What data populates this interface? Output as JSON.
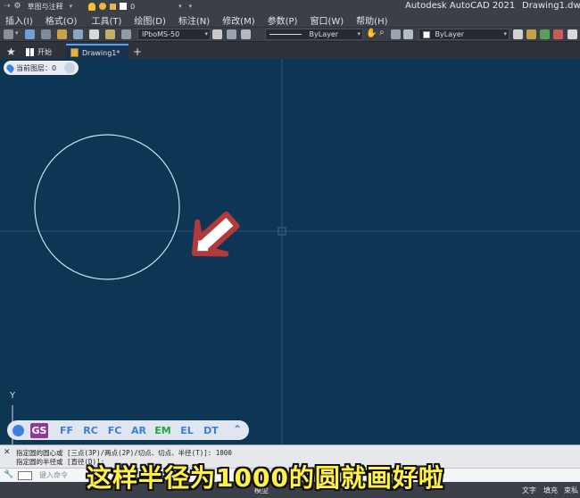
{
  "quick_access": {
    "workspace": "草图与注释",
    "layer": "0"
  },
  "title": {
    "app": "Autodesk AutoCAD 2021",
    "file": "Drawing1.dwg"
  },
  "menu": [
    "插入(I)",
    "格式(O)",
    "工具(T)",
    "绘图(D)",
    "标注(N)",
    "修改(M)",
    "参数(P)",
    "窗口(W)",
    "帮助(H)"
  ],
  "toolbar": {
    "dimstyle": "IPboMS-50",
    "linetype": "ByLayer",
    "color": "ByLayer"
  },
  "tabs": {
    "start": "开始",
    "drawing": "Drawing1*"
  },
  "canvas": {
    "layer_label": "当前图层：0",
    "axis_y": "Y",
    "background": "#0d3554"
  },
  "quick_commands": [
    "GS",
    "FF",
    "RC",
    "FC",
    "AR",
    "EM",
    "EL",
    "DT"
  ],
  "command_history": [
    "指定圆的圆心或 [三点(3P)/两点(2P)/切点、切点、半径(T)]: 1000",
    "指定圆的半径或 [直径(D)]:"
  ],
  "command_input": {
    "placeholder": "键入命令"
  },
  "status": {
    "model": "模型",
    "text": "文字",
    "fill": "填充",
    "style": "束私"
  },
  "subtitle": "这样半径为1000的圆就画好啦",
  "colors": {
    "accent": "#4ca3ff",
    "subtitle": "#fff04a",
    "arrow": "#b23a3a"
  }
}
